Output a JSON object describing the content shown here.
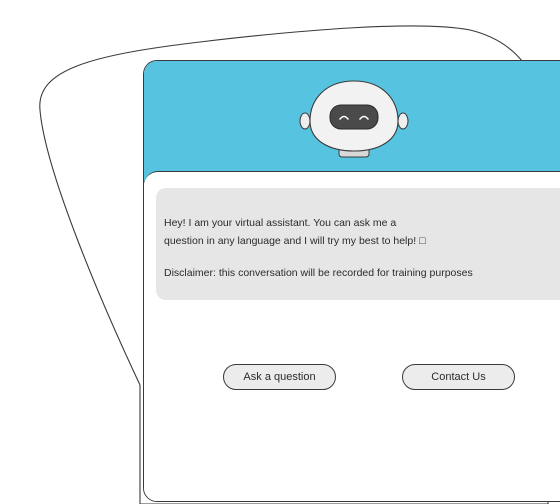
{
  "assistant": {
    "greeting_line_1": "Hey! I am your virtual assistant. You can ask me a",
    "greeting_line_2": "question in any language and I will try my best to help! □",
    "disclaimer": "Disclaimer: this conversation will be recorded for training purposes"
  },
  "actions": {
    "ask_label": "Ask a question",
    "contact_label": "Contact Us"
  },
  "colors": {
    "header_blue": "#56c4e0",
    "bubble_gray": "#e6e6e6",
    "button_gray": "#ececec",
    "outline": "#3a3a3a"
  },
  "icons": {
    "avatar": "robot-avatar-icon"
  }
}
